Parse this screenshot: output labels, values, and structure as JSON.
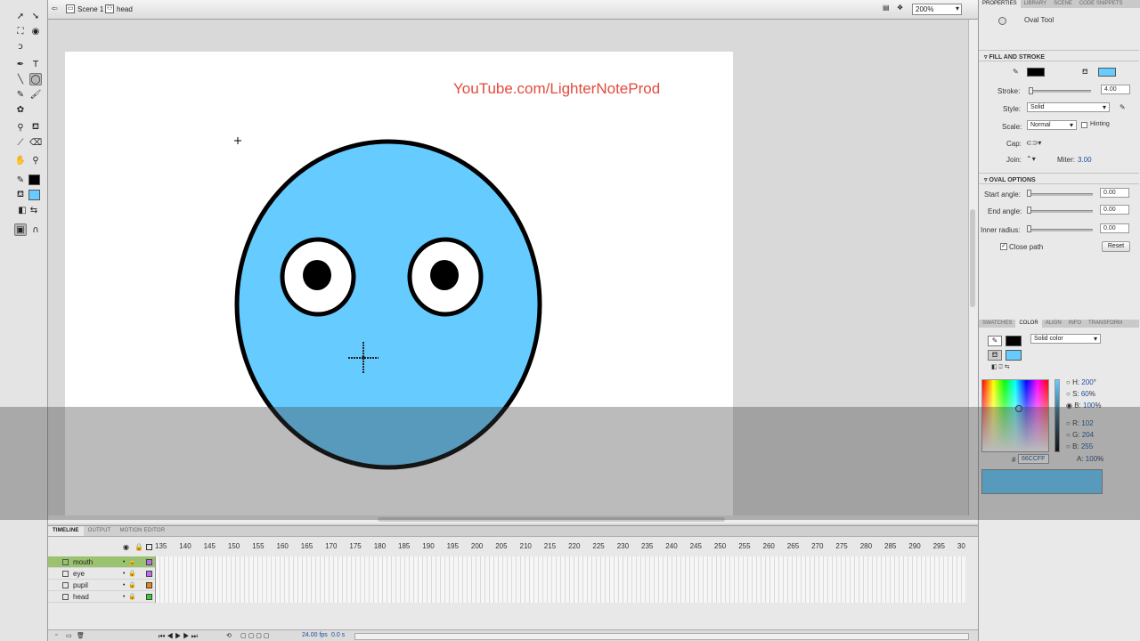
{
  "editbar": {
    "scene": "Scene 1",
    "symbol": "head",
    "zoom": "200%"
  },
  "stage": {
    "watermark": "YouTube.com/LighterNoteProd"
  },
  "colors": {
    "fill": "#66CCFF",
    "stroke": "#000000",
    "selected_layer": "#9BC36F"
  },
  "timeline": {
    "tabs": [
      "TIMELINE",
      "OUTPUT",
      "MOTION EDITOR"
    ],
    "ruler": [
      "135",
      "140",
      "145",
      "150",
      "155",
      "160",
      "165",
      "170",
      "175",
      "180",
      "185",
      "190",
      "195",
      "200",
      "205",
      "210",
      "215",
      "220",
      "225",
      "230",
      "235",
      "240",
      "245",
      "250",
      "255",
      "260",
      "265",
      "270",
      "275",
      "280",
      "285",
      "290",
      "295",
      "30"
    ],
    "layers": [
      {
        "name": "mouth",
        "color": "#b86cf0"
      },
      {
        "name": "eye",
        "color": "#b86cf0"
      },
      {
        "name": "pupil",
        "color": "#e8860c"
      },
      {
        "name": "head",
        "color": "#33cc33"
      }
    ],
    "fps": "24.00 fps",
    "time": "0.0 s"
  },
  "properties": {
    "tabs": [
      "PROPERTIES",
      "LIBRARY",
      "SCENE",
      "CODE SNIPPETS"
    ],
    "tool_name": "Oval Tool",
    "fill_stroke_header": "FILL AND STROKE",
    "stroke_label": "Stroke:",
    "stroke_value": "4.00",
    "stroke_fraction": 0.0,
    "style_label": "Style:",
    "style_value": "Solid",
    "scale_label": "Scale:",
    "scale_value": "Normal",
    "hinting_label": "Hinting",
    "cap_label": "Cap:",
    "join_label": "Join:",
    "miter_label": "Miter:",
    "miter_value": "3.00",
    "oval_header": "OVAL OPTIONS",
    "start_angle_label": "Start angle:",
    "start_angle_value": "0.00",
    "end_angle_label": "End angle:",
    "end_angle_value": "0.00",
    "inner_radius_label": "Inner radius:",
    "inner_radius_value": "0.00",
    "close_path_label": "Close path",
    "reset_label": "Reset"
  },
  "color_panel": {
    "tabs": [
      "SWATCHES",
      "COLOR",
      "ALIGN",
      "INFO",
      "TRANSFORM"
    ],
    "type": "Solid color",
    "h_label": "H:",
    "h_value": "200",
    "h_unit": "°",
    "s_label": "S:",
    "s_value": "60",
    "s_unit": "%",
    "b_label": "B:",
    "b_value": "100",
    "b_unit": "%",
    "r_label": "R:",
    "r_value": "102",
    "g_label": "G:",
    "g_value": "204",
    "bl_label": "B:",
    "bl_value": "255",
    "hex_label": "#",
    "hex_value": "66CCFF",
    "a_label": "A:",
    "a_value": "100",
    "a_unit": "%"
  }
}
